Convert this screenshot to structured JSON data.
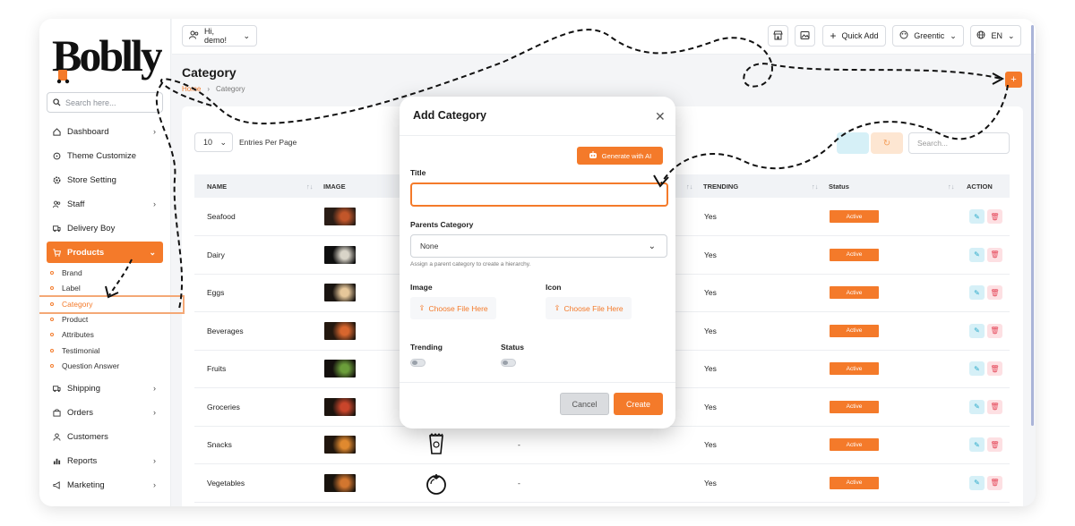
{
  "brand": {
    "logo_text": "Boblly",
    "accent": "#f47a2a"
  },
  "sidebar": {
    "search_placeholder": "Search here...",
    "items": [
      {
        "label": "Dashboard",
        "icon": "home-icon",
        "has_chevron": true
      },
      {
        "label": "Theme Customize",
        "icon": "palette-icon",
        "has_chevron": false
      },
      {
        "label": "Store Setting",
        "icon": "settings-icon",
        "has_chevron": false
      },
      {
        "label": "Staff",
        "icon": "users-icon",
        "has_chevron": true
      },
      {
        "label": "Delivery Boy",
        "icon": "truck-icon",
        "has_chevron": false
      },
      {
        "label": "Products",
        "icon": "cart-icon",
        "has_chevron": true,
        "active": true
      }
    ],
    "sub_items": [
      "Brand",
      "Label",
      "Category",
      "Product",
      "Attributes",
      "Testimonial",
      "Question Answer"
    ],
    "current_sub": "Category",
    "items_after": [
      {
        "label": "Shipping",
        "icon": "truck-icon",
        "has_chevron": true
      },
      {
        "label": "Orders",
        "icon": "bag-icon",
        "has_chevron": true
      },
      {
        "label": "Customers",
        "icon": "user-icon",
        "has_chevron": false
      },
      {
        "label": "Reports",
        "icon": "chart-icon",
        "has_chevron": true
      },
      {
        "label": "Marketing",
        "icon": "megaphone-icon",
        "has_chevron": true
      }
    ]
  },
  "topbar": {
    "greeting": "Hi, demo!",
    "quick_add": "Quick Add",
    "theme": "Greentic",
    "language": "EN"
  },
  "page": {
    "title": "Category",
    "breadcrumb": {
      "home": "Home",
      "current": "Category"
    },
    "add_button": "+"
  },
  "table": {
    "entries_value": "10",
    "entries_label": "Entries Per Page",
    "search_placeholder": "Search...",
    "headers": {
      "name": "NAME",
      "image": "IMAGE",
      "trending": "TRENDING",
      "status": "Status",
      "action": "ACTION"
    },
    "rows": [
      {
        "name": "Seafood",
        "trending": "Yes",
        "status": "Active",
        "icon_text": "",
        "thumb": [
          "#2a1d16",
          "#c2562a"
        ]
      },
      {
        "name": "Dairy",
        "trending": "Yes",
        "status": "Active",
        "icon_text": "",
        "thumb": [
          "#0e0e0e",
          "#d9d4c8"
        ]
      },
      {
        "name": "Eggs",
        "trending": "Yes",
        "status": "Active",
        "icon_text": "",
        "thumb": [
          "#1a1511",
          "#e6c79a"
        ]
      },
      {
        "name": "Beverages",
        "trending": "Yes",
        "status": "Active",
        "icon_text": "",
        "thumb": [
          "#24180f",
          "#d8662e"
        ]
      },
      {
        "name": "Fruits",
        "trending": "Yes",
        "status": "Active",
        "icon_text": "",
        "thumb": [
          "#14100d",
          "#6b9e3a"
        ]
      },
      {
        "name": "Groceries",
        "trending": "Yes",
        "status": "Active",
        "icon_text": "",
        "thumb": [
          "#1c140e",
          "#c9452b"
        ]
      },
      {
        "name": "Snacks",
        "trending": "Yes",
        "status": "Active",
        "icon_text": "-",
        "thumb": [
          "#21160d",
          "#e0892f"
        ]
      },
      {
        "name": "Vegetables",
        "trending": "Yes",
        "status": "Active",
        "icon_text": "-",
        "thumb": [
          "#19130d",
          "#d2762f"
        ]
      }
    ]
  },
  "modal": {
    "title": "Add Category",
    "generate_label": "Generate with AI",
    "title_label": "Title",
    "title_value": "",
    "parent_label": "Parents Category",
    "parent_value": "None",
    "parent_hint": "Assign a parent category to create a hierarchy.",
    "image_label": "Image",
    "icon_label": "Icon",
    "choose_file": "Choose File Here",
    "trending_label": "Trending",
    "status_label": "Status",
    "trending_on": false,
    "status_on": false,
    "cancel_label": "Cancel",
    "create_label": "Create"
  }
}
